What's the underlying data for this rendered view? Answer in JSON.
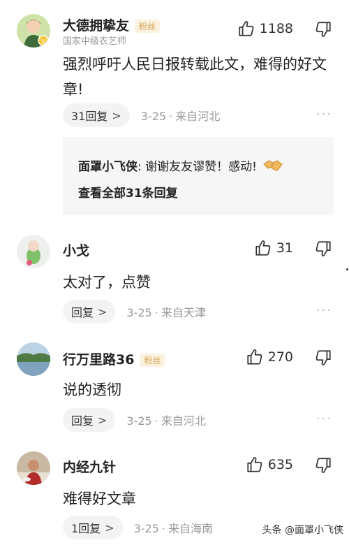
{
  "comments": [
    {
      "name": "大德拥挚友",
      "badge": "粉丝",
      "subtitle": "国家中级农艺师",
      "likes": "1188",
      "text": "强烈呼吁人民日报转载此文，难得的好文章!",
      "reply_label": "31回复",
      "date": "3-25",
      "location": "来自河北",
      "avatar_icon": "cartoon-boy-avatar"
    },
    {
      "name": "小戈",
      "likes": "31",
      "text": "太对了，点赞",
      "reply_label": "回复",
      "date": "3-25",
      "location": "来自天津",
      "avatar_icon": "toy-figure-avatar"
    },
    {
      "name": "行万里路36",
      "badge": "粉丝",
      "likes": "270",
      "text": "说的透彻",
      "reply_label": "回复",
      "date": "3-25",
      "location": "来自河北",
      "avatar_icon": "lake-landscape-avatar"
    },
    {
      "name": "内经九针",
      "likes": "635",
      "text": "难得好文章",
      "reply_label": "1回复",
      "date": "3-25",
      "location": "来自海南",
      "avatar_icon": "photo-person-avatar"
    }
  ],
  "nested_reply": {
    "author": "面罩小飞侠",
    "separator": ":",
    "text": "谢谢友友谬赞！感动!",
    "emoji": "handshake-icon",
    "view_all": "查看全部31条回复"
  },
  "dot_separator": "·",
  "chevron": ">",
  "more_label": "···",
  "watermark": "头条 @面罩小飞侠",
  "colors": {
    "badge_text": "#d9a85b",
    "badge_bg": "#fbf1df",
    "muted": "#999999",
    "pill_bg": "#f3f3f3"
  }
}
